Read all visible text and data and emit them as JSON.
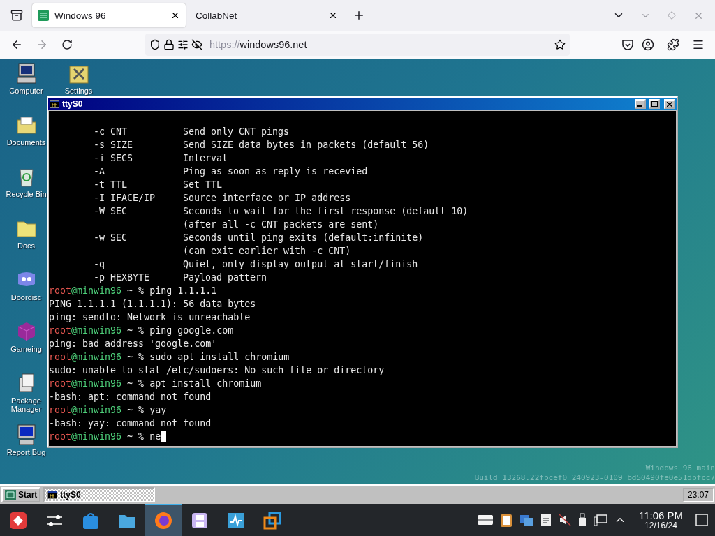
{
  "browser": {
    "tabs": [
      {
        "title": "Windows 96",
        "selected": true
      },
      {
        "title": "CollabNet",
        "selected": false
      }
    ],
    "url": {
      "scheme": "https://",
      "host": "windows96.net"
    }
  },
  "desktop": {
    "icon_columns": [
      [
        {
          "label": "Computer"
        },
        {
          "label": "Documents"
        },
        {
          "label": "Recycle Bin"
        },
        {
          "label": "Docs"
        },
        {
          "label": "Doordisc"
        },
        {
          "label": "Gameing"
        },
        {
          "label": "Package Manager"
        },
        {
          "label": "Report Bug"
        }
      ],
      [
        {
          "label": "Settings"
        }
      ]
    ],
    "build_info": [
      "Windows 96 main",
      "Build 13268.22fbcef0 240923-0109 bd50490fe0e51dbfcc7"
    ]
  },
  "window": {
    "title": "ttyS0",
    "lines": [
      {
        "kind": "option",
        "flag": "-c CNT",
        "description": "Send only CNT pings"
      },
      {
        "kind": "option",
        "flag": "-s SIZE",
        "description": "Send SIZE data bytes in packets (default 56)"
      },
      {
        "kind": "option",
        "flag": "-i SECS",
        "description": "Interval"
      },
      {
        "kind": "option",
        "flag": "-A",
        "description": "Ping as soon as reply is recevied"
      },
      {
        "kind": "option",
        "flag": "-t TTL",
        "description": "Set TTL"
      },
      {
        "kind": "option",
        "flag": "-I IFACE/IP",
        "description": "Source interface or IP address"
      },
      {
        "kind": "option",
        "flag": "-W SEC",
        "description": "Seconds to wait for the first response (default 10)"
      },
      {
        "kind": "note",
        "description": "(after all -c CNT packets are sent)"
      },
      {
        "kind": "option",
        "flag": "-w SEC",
        "description": "Seconds until ping exits (default:infinite)"
      },
      {
        "kind": "note",
        "description": "(can exit earlier with -c CNT)"
      },
      {
        "kind": "option",
        "flag": "-q",
        "description": "Quiet, only display output at start/finish"
      },
      {
        "kind": "option",
        "flag": "-p HEXBYTE",
        "description": "Payload pattern"
      },
      {
        "kind": "prompt",
        "user": "root",
        "host": "@minwin96",
        "path": "~ %",
        "command": "ping 1.1.1.1",
        "cursor": false
      },
      {
        "kind": "output",
        "text": "PING 1.1.1.1 (1.1.1.1): 56 data bytes"
      },
      {
        "kind": "output",
        "text": "ping: sendto: Network is unreachable"
      },
      {
        "kind": "prompt",
        "user": "root",
        "host": "@minwin96",
        "path": "~ %",
        "command": "ping google.com",
        "cursor": false
      },
      {
        "kind": "output",
        "text": "ping: bad address 'google.com'"
      },
      {
        "kind": "prompt",
        "user": "root",
        "host": "@minwin96",
        "path": "~ %",
        "command": "sudo apt install chromium",
        "cursor": false
      },
      {
        "kind": "output",
        "text": "sudo: unable to stat /etc/sudoers: No such file or directory"
      },
      {
        "kind": "prompt",
        "user": "root",
        "host": "@minwin96",
        "path": "~ %",
        "command": "apt install chromium",
        "cursor": false
      },
      {
        "kind": "output",
        "text": "-bash: apt: command not found"
      },
      {
        "kind": "prompt",
        "user": "root",
        "host": "@minwin96",
        "path": "~ %",
        "command": "yay",
        "cursor": false
      },
      {
        "kind": "output",
        "text": "-bash: yay: command not found"
      },
      {
        "kind": "prompt",
        "user": "root",
        "host": "@minwin96",
        "path": "~ %",
        "command": "ne",
        "cursor": true
      }
    ]
  },
  "win96_taskbar": {
    "start": "Start",
    "tasks": [
      {
        "title": "ttyS0",
        "selected": true
      }
    ],
    "clock": "23:07"
  },
  "host_taskbar": {
    "apps": [
      {
        "selected": false
      },
      {
        "selected": false
      },
      {
        "selected": false
      },
      {
        "selected": false
      },
      {
        "selected": true
      },
      {
        "selected": false
      },
      {
        "selected": false
      },
      {
        "selected": false
      }
    ],
    "clock": {
      "time": "11:06 PM",
      "date": "12/16/24"
    }
  }
}
